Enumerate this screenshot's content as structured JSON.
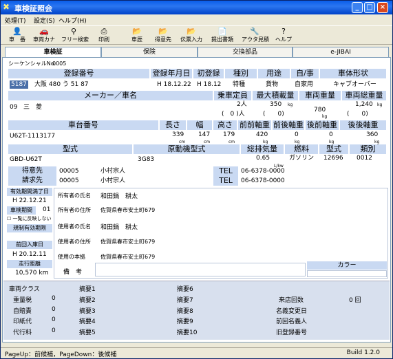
{
  "window": {
    "title": "車検証照会"
  },
  "menu": [
    "処理(T)",
    "設定(S)",
    "ヘルプ(H)"
  ],
  "toolbar": [
    {
      "icon": "person-icon",
      "label": "車　番"
    },
    {
      "icon": "car-icon",
      "label": "車両カナ"
    },
    {
      "icon": "search-icon",
      "label": "フリー検索"
    },
    {
      "icon": "print-icon",
      "label": "印刷"
    },
    {
      "icon": "history-icon",
      "label": "車歴"
    },
    {
      "icon": "customer-icon",
      "label": "得意先"
    },
    {
      "icon": "slip-icon",
      "label": "伝票入力"
    },
    {
      "icon": "document-icon",
      "label": "提出書類"
    },
    {
      "icon": "estimate-icon",
      "label": "アウタ見積"
    },
    {
      "icon": "help-icon",
      "label": "ヘルプ"
    }
  ],
  "tabs": [
    "車検証",
    "保険",
    "交換部品",
    "e-JIBAI"
  ],
  "sequence": {
    "label": "シーケンシャルNo.",
    "value": "0005"
  },
  "reg": {
    "h_no": "登録番号",
    "h_date": "登録年月日",
    "h_first": "初登録",
    "h_kind": "種別",
    "h_use": "用途",
    "h_self": "自/事",
    "h_shape": "車体形状",
    "code": "5187",
    "number": "大阪 480 う 51 87",
    "date": "H 18.12.22",
    "first": "H 18.12",
    "kind": "特種",
    "use": "貨物",
    "self": "自家用",
    "shape": "キャブオーバー"
  },
  "maker": {
    "h": "メーカー／車名",
    "h_cap": "乗車定員",
    "h_load": "最大積載量",
    "h_weight": "車両重量",
    "h_total": "車両総重量",
    "code": "09",
    "name": "三　菱",
    "cap1": "2人",
    "cap2": "(　0 )人",
    "load1": "350",
    "load2": "(　　0)",
    "weight": "780",
    "total1": "1,240",
    "total2": "(　　0)",
    "unit": "kg"
  },
  "chassis": {
    "h": "車台番号",
    "h_len": "長さ",
    "h_wid": "幅",
    "h_hei": "高さ",
    "h_ff": "前前軸重",
    "h_fr": "前後軸重",
    "h_rf": "後前軸重",
    "h_rr": "後後軸重",
    "value": "U62T-1113177",
    "len": "339",
    "wid": "147",
    "hei": "179",
    "ff": "420",
    "fr": "0",
    "rf": "0",
    "rr": "360",
    "cm": "cm",
    "kg": "kg"
  },
  "model": {
    "h": "型式",
    "h_engine": "原動機型式",
    "h_disp": "総排気量",
    "h_fuel": "燃料",
    "h_type": "型式",
    "h_class": "類別",
    "value": "GBD-U62T",
    "engine": "3G83",
    "disp": "0.65",
    "disp_unit": "L/kw",
    "fuel": "ガソリン",
    "type": "12696",
    "class": "0012"
  },
  "customer": {
    "label": "得意先",
    "code": "00005",
    "name": "小村宗人",
    "tel_label": "TEL",
    "tel": "06-6378-0000"
  },
  "billing": {
    "label": "請求先",
    "code": "00005",
    "name": "小村宗人",
    "tel_label": "TEL",
    "tel": "06-6378-0000"
  },
  "left": {
    "expiry_label": "有効期間満了日",
    "expiry": "H 22.12.21",
    "period_label": "車検期間",
    "period": "01",
    "nomatch": "一覧に反映しない",
    "regulation": "規制有効期限",
    "prev_label": "前回入庫日",
    "prev": "H 20.12.11",
    "mileage_label": "走行距離",
    "mileage": "10,570 km"
  },
  "owner": {
    "name_label": "所有者の氏名",
    "name": "和田鍋　耕太",
    "addr_label": "所有者の住所",
    "addr": "佐賀県春市安土町679"
  },
  "user": {
    "name_label": "使用者の氏名",
    "name": "和田鍋　耕太",
    "addr_label": "使用者の住所",
    "addr": "佐賀県春市安土町679",
    "base_label": "使用の本拠",
    "base": "佐賀県春市安土町679"
  },
  "note": {
    "label": "備　考",
    "color_label": "カラー"
  },
  "lower": {
    "class_label": "車両クラス",
    "fees": [
      {
        "label": "重量税",
        "value": "0"
      },
      {
        "label": "自賠責",
        "value": "0"
      },
      {
        "label": "印紙代",
        "value": "0"
      },
      {
        "label": "代行料",
        "value": "0"
      }
    ],
    "summary1": [
      "摘要1",
      "摘要2",
      "摘要3",
      "摘要4",
      "摘要5"
    ],
    "summary2": [
      "摘要6",
      "摘要7",
      "摘要8",
      "摘要9",
      "摘要10"
    ],
    "right": [
      {
        "label": "来店回数",
        "value": "0 回"
      },
      {
        "label": "名義変更日",
        "value": ""
      },
      {
        "label": "前回名義人",
        "value": ""
      },
      {
        "label": "旧登録番号",
        "value": ""
      }
    ]
  },
  "status": {
    "left": "PageUp：前候補，PageDown：後候補",
    "right": "Build 1.2.0"
  }
}
